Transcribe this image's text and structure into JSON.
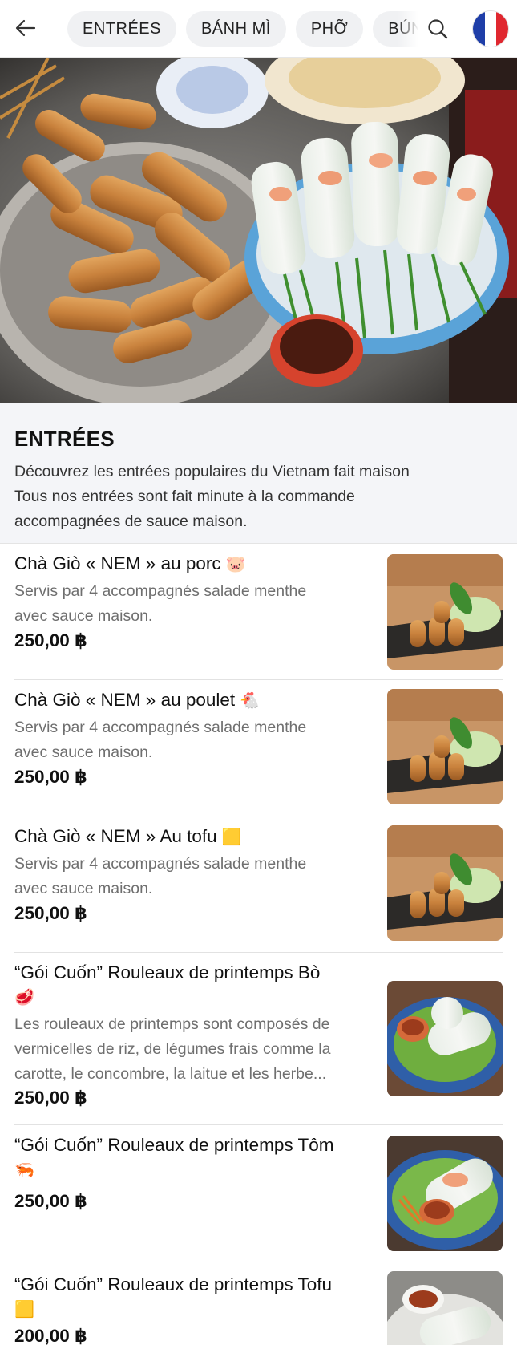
{
  "nav": {
    "tabs": [
      "ENTRÉES",
      "BÁNH MÌ",
      "PHỠ",
      "BÚN"
    ]
  },
  "section": {
    "title": "ENTRÉES",
    "description_lines": [
      "Découvrez les entrées populaires du Vietnam fait maison",
      "Tous nos entrées sont fait minute à la commande",
      "accompagnées de sauce maison."
    ]
  },
  "items": [
    {
      "name": "Chà Giò « NEM » au porc",
      "emoji": "🐷",
      "desc_lines": [
        "Servis par 4 accompagnés salade menthe",
        "avec sauce maison."
      ],
      "price": "250,00 ฿"
    },
    {
      "name": "Chà Giò « NEM » au poulet",
      "emoji": "🐔",
      "desc_lines": [
        "Servis par 4 accompagnés salade menthe",
        "avec sauce maison."
      ],
      "price": "250,00 ฿"
    },
    {
      "name": "Chà Giò « NEM » Au tofu",
      "emoji": "🟨",
      "desc_lines": [
        "Servis par 4 accompagnés salade menthe",
        "avec sauce maison."
      ],
      "price": "250,00 ฿"
    },
    {
      "name_lines": [
        "“Gói Cuốn” Rouleaux de printemps Bò"
      ],
      "emoji": "🥩",
      "desc_lines": [
        "Les rouleaux de printemps sont composés de",
        "vermicelles de riz, de légumes frais comme la",
        "carotte, le concombre, la laitue et les herbe..."
      ],
      "price": "250,00 ฿"
    },
    {
      "name_lines": [
        "“Gói Cuốn” Rouleaux de printemps Tôm"
      ],
      "emoji": "🦐",
      "price": "250,00 ฿"
    },
    {
      "name_lines": [
        "“Gói Cuốn” Rouleaux de printemps Tofu"
      ],
      "emoji": "🟨",
      "price": "200,00 ฿"
    }
  ],
  "colors": {
    "flag_blue": "#1f3ea8",
    "flag_white": "#ffffff",
    "flag_red": "#e0272f",
    "section_bg": "#f4f5f8"
  },
  "icons": [
    "back-arrow-icon",
    "search-icon",
    "french-flag-icon"
  ]
}
